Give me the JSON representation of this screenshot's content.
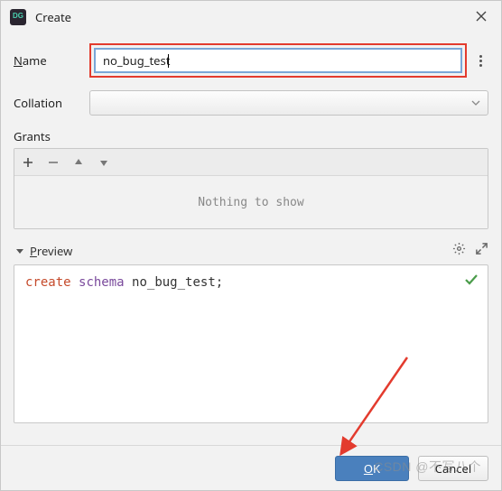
{
  "window": {
    "title": "Create"
  },
  "form": {
    "name_label": "Name",
    "name_value": "no_bug_test",
    "collation_label": "Collation",
    "collation_value": "",
    "grants_label": "Grants",
    "grants_empty": "Nothing to show"
  },
  "preview": {
    "title_prefix": "P",
    "title_rest": "review",
    "sql_kw_create": "create",
    "sql_kw_schema": "schema",
    "sql_ident": "no_bug_test",
    "sql_tail": ";"
  },
  "footer": {
    "ok_prefix": "O",
    "ok_rest": "K",
    "cancel": "Cancel"
  },
  "watermark": "CSDN @不写八个"
}
